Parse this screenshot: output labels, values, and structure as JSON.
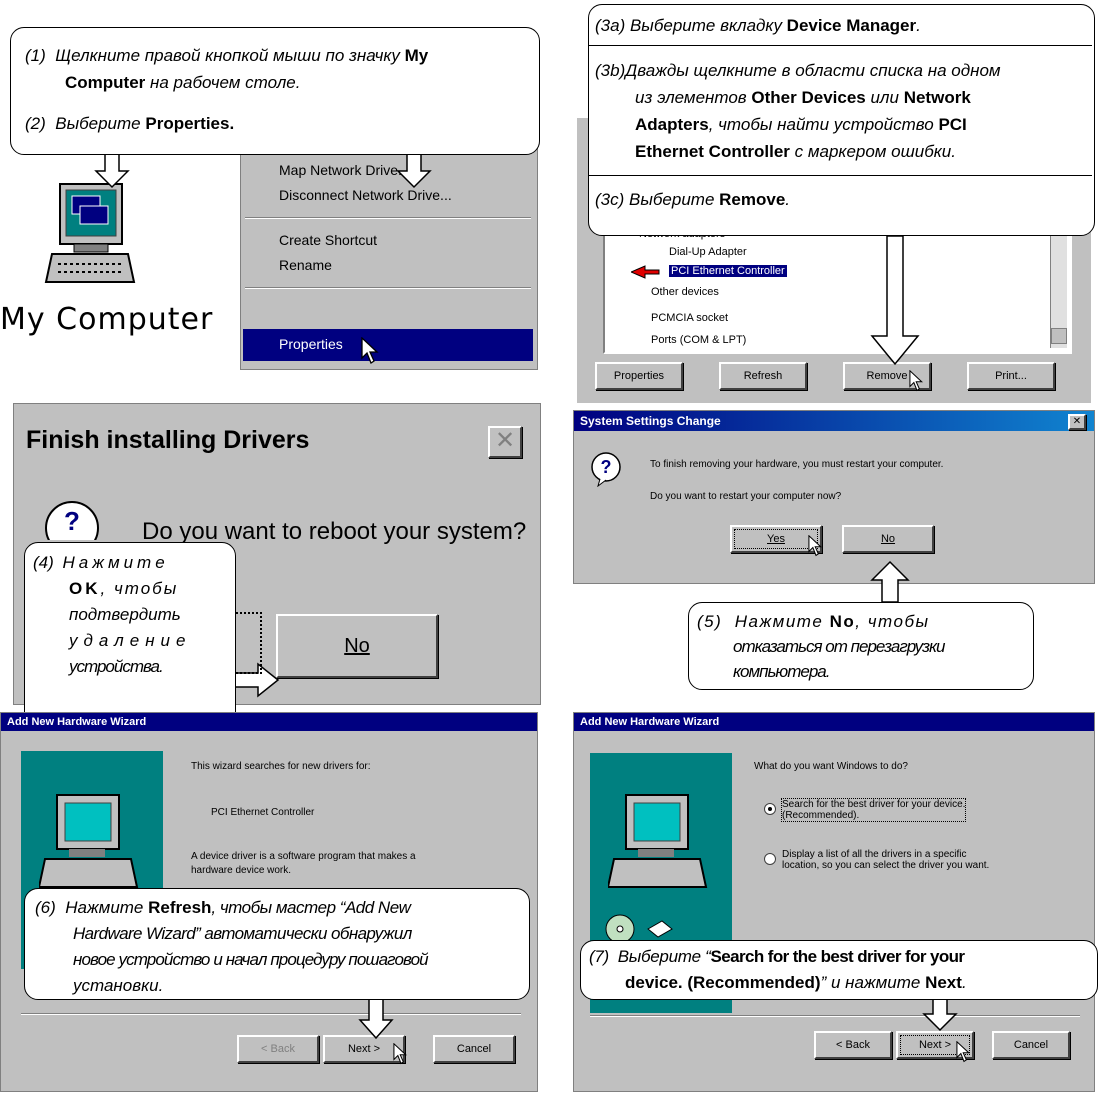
{
  "step1": {
    "prefix": "(1)",
    "text1": "Щелкните правой кнопкой мыши по значку ",
    "bold1": "My",
    "bold2": "Computer",
    "text2": " на рабочем столе."
  },
  "step2": {
    "prefix": "(2)",
    "text1": "Выберите ",
    "bold1": "Properties."
  },
  "desktop_icon_label": "My Computer",
  "context_menu": {
    "items": [
      "Map Network Drive...",
      "Disconnect Network Drive...",
      "Create Shortcut",
      "Rename",
      "Properties"
    ],
    "selected": "Properties"
  },
  "step3a": {
    "prefix": "(3a)",
    "text1": "Выберите вкладку ",
    "bold1": "Device Manager",
    "text2": "."
  },
  "step3b": {
    "prefix": "(3b)",
    "text1": "Дважды щелкните в области списка на одном",
    "text2": "из элементов ",
    "bold1": "Other Devices",
    "text3": " или ",
    "bold2": "Network",
    "bold3": "Adapters",
    "text4": ", чтобы найти устройство ",
    "bold4": "PCI",
    "bold5": "Ethernet Controller",
    "text5": " с маркером ошибки."
  },
  "step3c": {
    "prefix": "(3c)",
    "text1": "Выберите ",
    "bold1": "Remove",
    "text2": "."
  },
  "device_manager": {
    "tree": [
      "Network adapters",
      "Dial-Up Adapter",
      "PCI Ethernet Controller",
      "Other devices",
      "PCMCIA socket",
      "Ports (COM & LPT)"
    ],
    "buttons": [
      "Properties",
      "Refresh",
      "Remove",
      "Print..."
    ]
  },
  "finish_dialog": {
    "title": "Finish installing Drivers",
    "question": "Do you want to reboot your system?",
    "no_label": "No"
  },
  "step4": {
    "prefix": "(4)",
    "l1": "Нажмите",
    "bold1": "OK",
    "l2": ", чтобы",
    "l3": "подтвердить",
    "l4": "удаление",
    "l5": "устройства."
  },
  "sys_settings": {
    "title": "System Settings Change",
    "line1": "To finish removing your hardware, you must restart your computer.",
    "line2": "Do you want to restart your computer now?",
    "yes": "Yes",
    "no": "No"
  },
  "step5": {
    "prefix": "(5)",
    "text1": "Нажмите ",
    "bold1": "No",
    "text2": ", чтобы",
    "l2": "отказаться от перезагрузки",
    "l3": "компьютера."
  },
  "wizard1": {
    "title": "Add New Hardware Wizard",
    "line1": "This wizard searches for new drivers for:",
    "device": "PCI Ethernet Controller",
    "line2": "A device driver is a software program that makes a",
    "line3": "hardware device work.",
    "back": "< Back",
    "next": "Next >",
    "cancel": "Cancel"
  },
  "step6": {
    "prefix": "(6)",
    "text1": "Нажмите ",
    "bold1": "Refresh",
    "text2": ", чтобы мастер “Add New",
    "l2": "Hardware Wizard” автоматически обнаружил",
    "l3": "новое устройство и начал процедуру пошаговой",
    "l4": "установки."
  },
  "wizard2": {
    "title": "Add New Hardware Wizard",
    "question": "What do you want Windows to do?",
    "opt1a": "Search for the best driver for your device.",
    "opt1b": "(Recommended).",
    "opt2a": "Display a list of all the drivers in a specific",
    "opt2b": "location, so you can select the driver you want.",
    "back": "< Back",
    "next": "Next >",
    "cancel": "Cancel"
  },
  "step7": {
    "prefix": "(7)",
    "text1": "Выберите “",
    "bold1": "Search for the best driver for your",
    "bold2": "device. (Recommended)",
    "text2": "” и нажмите ",
    "bold3": "Next",
    "text3": "."
  }
}
